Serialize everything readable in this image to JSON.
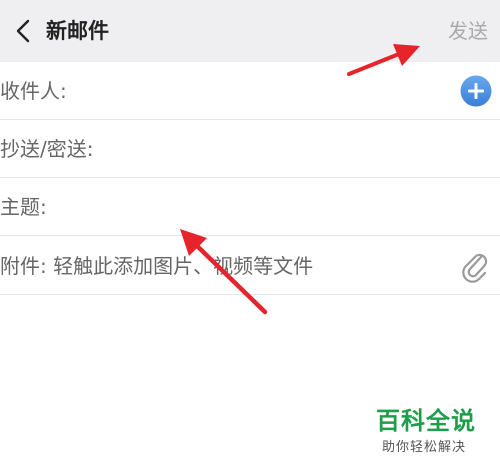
{
  "header": {
    "back_icon": "chevron-left-icon",
    "title": "新邮件",
    "send_label": "发送"
  },
  "fields": {
    "recipient_label": "收件人:",
    "cc_bcc_label": "抄送/密送:",
    "subject_label": "主题:",
    "attachment_label": "附件: 轻触此添加图片、视频等文件"
  },
  "icons": {
    "add_contact": "plus-circle-icon",
    "attachment": "paperclip-icon"
  },
  "colors": {
    "header_bg": "#efeff1",
    "accent_blue": "#4a8fe0",
    "annotation_red": "#e5242b",
    "watermark_green": "#1e9e4a"
  },
  "watermark": {
    "main": "百科全说",
    "sub": "助你轻松解决"
  }
}
